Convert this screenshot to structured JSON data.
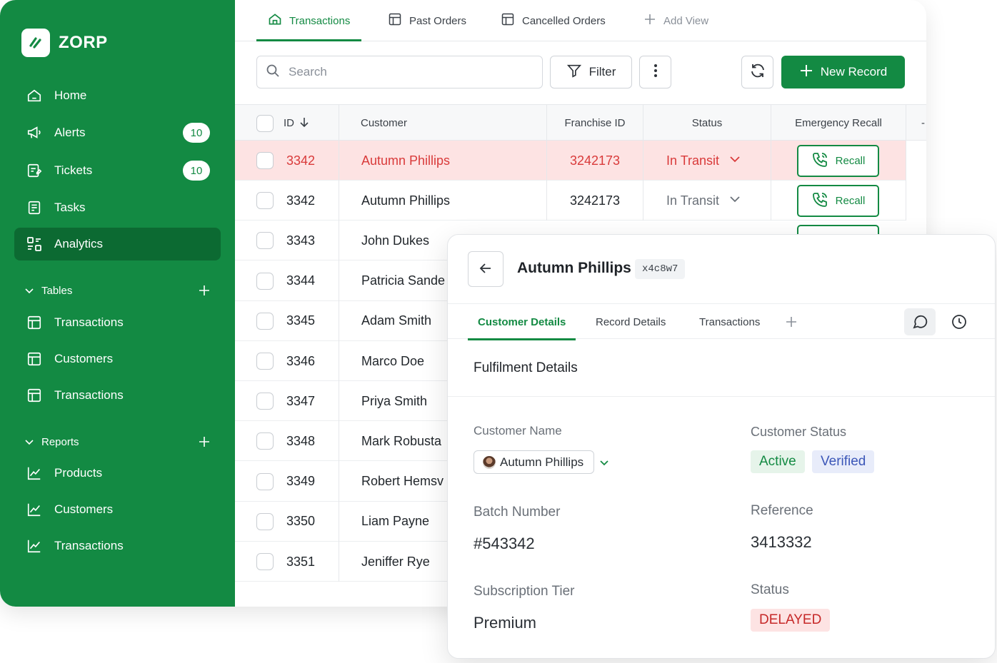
{
  "app": {
    "name": "ZORP"
  },
  "sidebar": {
    "items": [
      {
        "label": "Home",
        "icon": "home-icon"
      },
      {
        "label": "Alerts",
        "icon": "megaphone-icon",
        "badge": "10"
      },
      {
        "label": "Tickets",
        "icon": "ticket-icon",
        "badge": "10"
      },
      {
        "label": "Tasks",
        "icon": "task-icon"
      },
      {
        "label": "Analytics",
        "icon": "analytics-icon",
        "active": true
      }
    ],
    "tables": {
      "title": "Tables",
      "items": [
        {
          "label": "Transactions"
        },
        {
          "label": "Customers"
        },
        {
          "label": "Transactions"
        }
      ]
    },
    "reports": {
      "title": "Reports",
      "items": [
        {
          "label": "Products"
        },
        {
          "label": "Customers"
        },
        {
          "label": "Transactions"
        }
      ]
    }
  },
  "tabs": [
    {
      "label": "Transactions",
      "active": true
    },
    {
      "label": "Past Orders"
    },
    {
      "label": "Cancelled Orders"
    },
    {
      "label": "Add View"
    }
  ],
  "toolbar": {
    "search_placeholder": "Search",
    "filter_label": "Filter",
    "new_record_label": "New Record"
  },
  "table": {
    "columns": [
      "ID",
      "Customer",
      "Franchise ID",
      "Status",
      "Emergency Recall"
    ],
    "rows": [
      {
        "id": "3342",
        "customer": "Autumn Phillips",
        "franchise": "3242173",
        "status": "In Transit",
        "recall": "Recall",
        "highlight": true
      },
      {
        "id": "3342",
        "customer": "Autumn Phillips",
        "franchise": "3242173",
        "status": "In Transit",
        "recall": "Recall"
      },
      {
        "id": "3343",
        "customer": "John Dukes"
      },
      {
        "id": "3344",
        "customer": "Patricia Sande"
      },
      {
        "id": "3345",
        "customer": "Adam Smith"
      },
      {
        "id": "3346",
        "customer": "Marco Doe"
      },
      {
        "id": "3347",
        "customer": "Priya Smith"
      },
      {
        "id": "3348",
        "customer": "Mark Robusta"
      },
      {
        "id": "3349",
        "customer": "Robert Hemsv"
      },
      {
        "id": "3350",
        "customer": "Liam Payne"
      },
      {
        "id": "3351",
        "customer": "Jeniffer Rye"
      }
    ]
  },
  "panel": {
    "title": "Autumn Phillips",
    "code": "x4c8w7",
    "tabs": [
      "Customer Details",
      "Record Details",
      "Transactions"
    ],
    "section_title": "Fulfilment Details",
    "fields": {
      "customer_name_label": "Customer Name",
      "customer_name_value": "Autumn Phillips",
      "customer_status_label": "Customer Status",
      "status_chips": [
        {
          "label": "Active",
          "bg": "#e6f4ea",
          "fg": "#138a43"
        },
        {
          "label": "Verified",
          "bg": "#e8ecfa",
          "fg": "#3b56b8"
        }
      ],
      "batch_label": "Batch Number",
      "batch_value": "#543342",
      "reference_label": "Reference",
      "reference_value": "3413332",
      "tier_label": "Subscription Tier",
      "tier_value": "Premium",
      "status_label": "Status",
      "status_value": "DELAYED"
    }
  },
  "colors": {
    "brand": "#138a43",
    "brand_dark": "#0c6a32",
    "danger": "#d93a3a",
    "danger_bg": "#fde3e3"
  }
}
